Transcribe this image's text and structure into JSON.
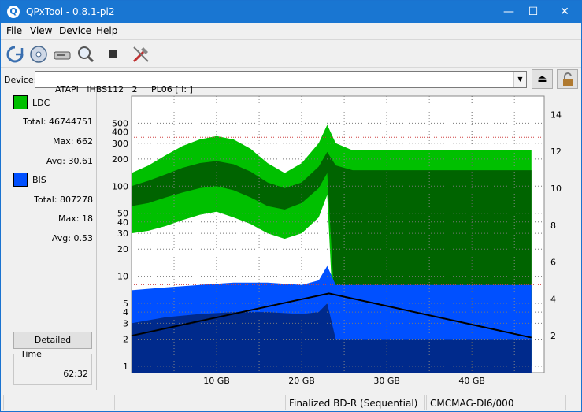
{
  "window": {
    "title": "QPxTool - 0.8.1-pl2",
    "app_icon": "Q",
    "minimize": "—",
    "maximize": "☐",
    "close": "✕"
  },
  "menu": [
    "File",
    "View",
    "Device",
    "Help"
  ],
  "toolbar": {
    "icons": [
      "refresh-icon",
      "disc-scan-icon",
      "drive-icon",
      "zoom-icon",
      "stop-icon",
      "tools-icon"
    ]
  },
  "device": {
    "label": "Device:",
    "value": "ATAPI   iHBS112   2     PL06 [ I: ]"
  },
  "ldc": {
    "name": "LDC",
    "color": "#00c000",
    "total_label": "Total:",
    "total": "46744751",
    "max_label": "Max:",
    "max": "662",
    "avg_label": "Avg:",
    "avg": "30.61"
  },
  "bis": {
    "name": "BIS",
    "color": "#0050ff",
    "total_label": "Total:",
    "total": "807278",
    "max_label": "Max:",
    "max": "18",
    "avg_label": "Avg:",
    "avg": "0.53"
  },
  "detailed_label": "Detailed",
  "time": {
    "label": "Time",
    "value": "62:32"
  },
  "status": {
    "cell1": "",
    "cell2": "",
    "disc_type": "Finalized BD-R (Sequential)",
    "media_id": "CMCMAG-DI6/000"
  },
  "chart_data": {
    "type": "area",
    "x_ticks": [
      "10 GB",
      "20 GB",
      "30 GB",
      "40 GB"
    ],
    "x_tick_values": [
      10,
      20,
      30,
      40
    ],
    "xlim": [
      0,
      48.5
    ],
    "y_left_ticks": [
      "1",
      "2",
      "3",
      "4",
      "5",
      "10",
      "20",
      "30",
      "40",
      "50",
      "100",
      "200",
      "300",
      "400",
      "500"
    ],
    "y_left_tick_values": [
      1,
      2,
      3,
      4,
      5,
      10,
      20,
      30,
      40,
      50,
      100,
      200,
      300,
      400,
      500
    ],
    "y_left_scale": "log",
    "y_left_lim": [
      0.85,
      1000
    ],
    "y_right_ticks": [
      "2",
      "4",
      "6",
      "8",
      "10",
      "12",
      "14"
    ],
    "y_right_tick_values": [
      2,
      4,
      6,
      8,
      10,
      12,
      14
    ],
    "y_right_lim": [
      0,
      15
    ],
    "series": [
      {
        "name": "LDC",
        "color_light": "#00c000",
        "color_dark": "#006400",
        "x": [
          0,
          2,
          4,
          6,
          8,
          10,
          12,
          14,
          16,
          18,
          20,
          22,
          23,
          24,
          26,
          28,
          30,
          32,
          34,
          36,
          38,
          40,
          42,
          44,
          46,
          47
        ],
        "max": [
          140,
          170,
          220,
          280,
          330,
          360,
          330,
          260,
          180,
          140,
          180,
          300,
          480,
          300,
          250,
          250,
          250,
          250,
          250,
          250,
          250,
          250,
          250,
          250,
          250,
          250
        ],
        "upper": [
          100,
          115,
          135,
          160,
          180,
          190,
          175,
          145,
          110,
          95,
          110,
          165,
          240,
          170,
          150,
          150,
          150,
          150,
          150,
          150,
          150,
          150,
          150,
          150,
          150,
          150
        ],
        "lower": [
          60,
          65,
          75,
          85,
          95,
          100,
          90,
          75,
          60,
          55,
          65,
          95,
          140,
          3,
          3,
          3,
          3,
          3,
          3,
          3,
          3,
          3,
          3,
          3,
          3,
          3
        ],
        "min": [
          30,
          32,
          36,
          42,
          48,
          52,
          45,
          38,
          30,
          26,
          30,
          45,
          80,
          1,
          1,
          1,
          1,
          1,
          1,
          1,
          1,
          1,
          1,
          1,
          1,
          1
        ]
      },
      {
        "name": "BIS",
        "color_light": "#0050ff",
        "color_dark": "#002a8c",
        "x": [
          0,
          4,
          8,
          12,
          16,
          20,
          22,
          23,
          24,
          28,
          32,
          36,
          40,
          44,
          47
        ],
        "upper": [
          7,
          7.5,
          8,
          8.5,
          8.5,
          8,
          9,
          13,
          8,
          8,
          8,
          8,
          8,
          8,
          8
        ],
        "lower": [
          3,
          3.5,
          3.8,
          4,
          4,
          3.8,
          4,
          5,
          2,
          2,
          2,
          2,
          2,
          2,
          2
        ]
      },
      {
        "name": "Speed",
        "color": "#000000",
        "x": [
          0,
          23.2,
          47
        ],
        "y": [
          2,
          4.3,
          1.9
        ]
      }
    ],
    "grid": true
  }
}
